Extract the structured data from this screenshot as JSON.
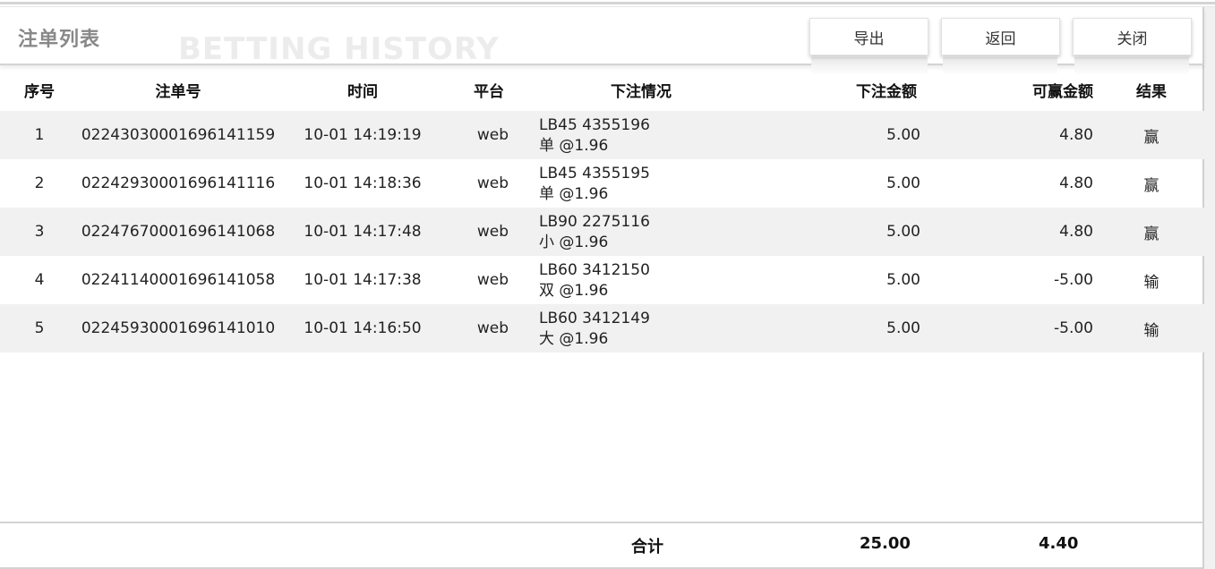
{
  "header": {
    "title": "注单列表",
    "watermark": "BETTING HISTORY",
    "buttons": {
      "export": "导出",
      "back": "返回",
      "close": "关闭"
    }
  },
  "table": {
    "columns": {
      "index": "序号",
      "order_no": "注单号",
      "time": "时间",
      "platform": "平台",
      "detail": "下注情况",
      "bet_amount": "下注金额",
      "win_amount": "可赢金额",
      "result": "结果"
    },
    "rows": [
      {
        "index": "1",
        "order_no": "02243030001696141159",
        "time": "10-01 14:19:19",
        "platform": "web",
        "detail_line1": "LB45 4355196",
        "detail_line2": "单 @1.96",
        "bet_amount": "5.00",
        "win_amount": "4.80",
        "result": "赢"
      },
      {
        "index": "2",
        "order_no": "02242930001696141116",
        "time": "10-01 14:18:36",
        "platform": "web",
        "detail_line1": "LB45 4355195",
        "detail_line2": "单 @1.96",
        "bet_amount": "5.00",
        "win_amount": "4.80",
        "result": "赢"
      },
      {
        "index": "3",
        "order_no": "02247670001696141068",
        "time": "10-01 14:17:48",
        "platform": "web",
        "detail_line1": "LB90 2275116",
        "detail_line2": "小 @1.96",
        "bet_amount": "5.00",
        "win_amount": "4.80",
        "result": "赢"
      },
      {
        "index": "4",
        "order_no": "02241140001696141058",
        "time": "10-01 14:17:38",
        "platform": "web",
        "detail_line1": "LB60 3412150",
        "detail_line2": "双 @1.96",
        "bet_amount": "5.00",
        "win_amount": "-5.00",
        "result": "输"
      },
      {
        "index": "5",
        "order_no": "02245930001696141010",
        "time": "10-01 14:16:50",
        "platform": "web",
        "detail_line1": "LB60 3412149",
        "detail_line2": "大 @1.96",
        "bet_amount": "5.00",
        "win_amount": "-5.00",
        "result": "输"
      }
    ]
  },
  "footer": {
    "label": "合计",
    "bet_total": "25.00",
    "win_total": "4.40"
  }
}
